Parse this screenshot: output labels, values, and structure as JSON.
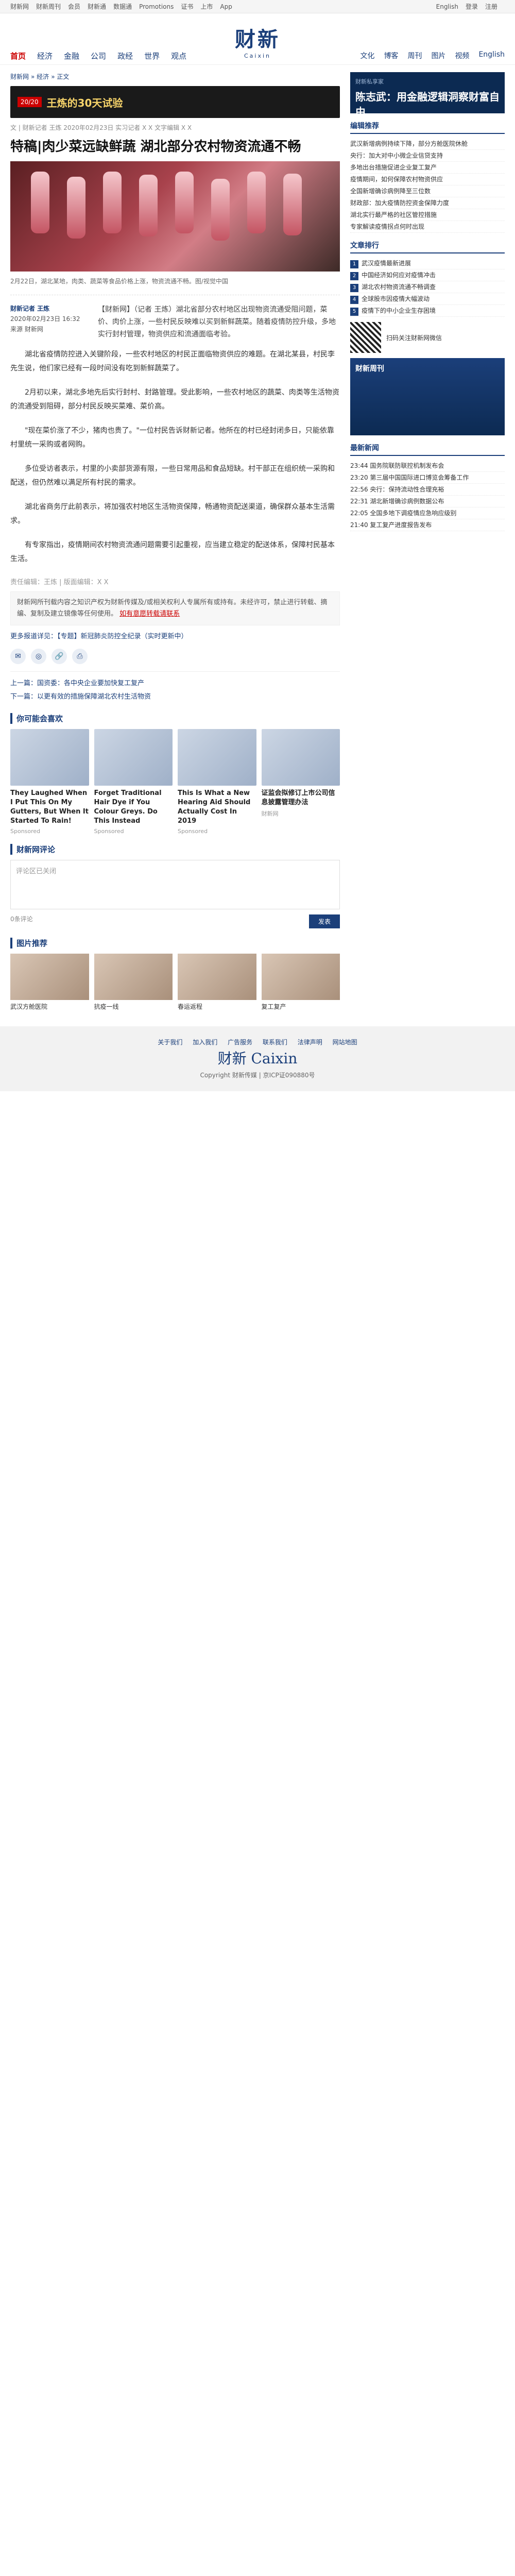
{
  "topbar": {
    "left": [
      "财新网",
      "财新周刊",
      "会员",
      "财新通",
      "数据通",
      "Promotions",
      "证书",
      "上市",
      "App"
    ],
    "right": [
      "English",
      "登录",
      "注册"
    ]
  },
  "header": {
    "logo_cn": "财新",
    "logo_en": "Caixin",
    "nav_left": [
      "首页",
      "经济",
      "金融",
      "公司",
      "政经",
      "世界",
      "观点"
    ],
    "nav_right": [
      "文化",
      "博客",
      "周刊",
      "图片",
      "视频",
      "English"
    ]
  },
  "breadcrumb": [
    "财新网",
    "经济",
    "正文"
  ],
  "promo": {
    "tag": "20/20",
    "text": "王炼的30天试验"
  },
  "meta": "文 | 财新记者 王炼 2020年02月23日 实习记者 X X 文字编辑 X X",
  "title": "特稿|肉少菜远缺鲜蔬 湖北部分农村物资流通不畅",
  "hero_caption": "2月22日，湖北某地，肉类、蔬菜等食品价格上涨，物资流通不畅。图/视觉中国",
  "author": {
    "name": "财新记者 王炼",
    "date": "2020年02月23日 16:32",
    "source": "来源 财新网"
  },
  "lead": "【财新网】（记者 王炼）湖北省部分农村地区出现物资流通受阻问题，菜价、肉价上涨，一些村民反映难以买到新鲜蔬菜。随着疫情防控升级，多地实行封村管理，物资供应和流通面临考验。",
  "body": [
    "湖北省疫情防控进入关键阶段，一些农村地区的村民正面临物资供应的难题。在湖北某县，村民李先生说，他们家已经有一段时间没有吃到新鲜蔬菜了。",
    "2月初以来，湖北多地先后实行封村、封路管理。受此影响，一些农村地区的蔬菜、肉类等生活物资的流通受到阻碍，部分村民反映买菜难、菜价高。",
    "\"现在菜价涨了不少，猪肉也贵了。\"一位村民告诉财新记者。他所在的村已经封闭多日，只能依靠村里统一采购或者网购。",
    "多位受访者表示，村里的小卖部货源有限，一些日常用品和食品短缺。村干部正在组织统一采购和配送，但仍然难以满足所有村民的需求。",
    "湖北省商务厅此前表示，将加强农村地区生活物资保障，畅通物资配送渠道，确保群众基本生活需求。",
    "有专家指出，疫情期间农村物资流通问题需要引起重视，应当建立稳定的配送体系，保障村民基本生活。"
  ],
  "editor": "责任编辑：王炼 | 版面编辑：X X",
  "notice": {
    "text": "财新网所刊载内容之知识产权为财新传媒及/或相关权利人专属所有或持有。未经许可，禁止进行转载、摘编、复制及建立镜像等任何使用。",
    "link": "如有意愿转载请联系"
  },
  "tagline": "更多报道详见：【专题】新冠肺炎防控全纪录（实时更新中）",
  "prevnext": [
    "上一篇：国资委：各中央企业要加快复工复产",
    "下一篇：以更有效的措施保障湖北农村生活物资"
  ],
  "recs_title": "你可能会喜欢",
  "recs": [
    {
      "cap": "They Laughed When I Put This On My Gutters, But When It Started To Rain!",
      "src": "Sponsored"
    },
    {
      "cap": "Forget Traditional Hair Dye if You Colour Greys. Do This Instead",
      "src": "Sponsored"
    },
    {
      "cap": "This Is What a New Hearing Aid Should Actually Cost In 2019",
      "src": "Sponsored"
    },
    {
      "cap": "证监会拟修订上市公司信息披露管理办法",
      "src": "财新网"
    }
  ],
  "comment": {
    "title": "财新网评论",
    "placeholder": "评论区已关闭",
    "count": "0条评论",
    "submit": "发表"
  },
  "pics_title": "图片推荐",
  "pics": [
    "武汉方舱医院",
    "抗疫一线",
    "春运返程",
    "复工复产"
  ],
  "side": {
    "ad_small": "财新私享家",
    "ad_big": "陈志武：用金融逻辑洞察财富自由",
    "hot_title": "编辑推荐",
    "hot": [
      "武汉新增病例持续下降，部分方舱医院休舱",
      "央行：加大对中小微企业信贷支持",
      "多地出台措施促进企业复工复产",
      "疫情期间，如何保障农村物资供应",
      "全国新增确诊病例降至三位数",
      "财政部：加大疫情防控资金保障力度",
      "湖北实行最严格的社区管控措施",
      "专家解读疫情拐点何时出现"
    ],
    "rank_title": "文章排行",
    "rank": [
      "武汉疫情最新进展",
      "中国经济如何应对疫情冲击",
      "湖北农村物资流通不畅调查",
      "全球股市因疫情大幅波动",
      "疫情下的中小企业生存困境"
    ],
    "qr_text": "扫码关注财新网微信",
    "book_title": "财新周刊",
    "news_title": "最新新闻",
    "news": [
      "23:44 国务院联防联控机制发布会",
      "23:20 第三届中国国际进口博览会筹备工作",
      "22:56 央行：保持流动性合理充裕",
      "22:31 湖北新增确诊病例数据公布",
      "22:05 全国多地下调疫情应急响应级别",
      "21:40 复工复产进度报告发布"
    ]
  },
  "footer": {
    "links": [
      "关于我们",
      "加入我们",
      "广告服务",
      "联系我们",
      "法律声明",
      "网站地图"
    ],
    "logo": "财新 Caixin",
    "copyright": "Copyright 财新传媒 | 京ICP证090880号"
  }
}
